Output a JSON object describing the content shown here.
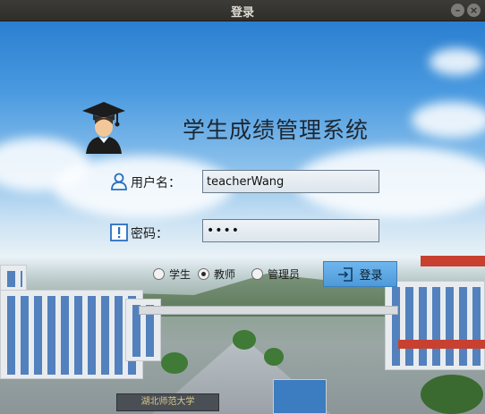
{
  "window": {
    "title": "登录"
  },
  "app": {
    "title": "学生成绩管理系统"
  },
  "form": {
    "username_label": "用户名：",
    "username_value": "teacherWang",
    "password_label": "密码：",
    "password_value": "••••"
  },
  "roles": [
    {
      "label": "学生",
      "checked": false
    },
    {
      "label": "教师",
      "checked": true
    },
    {
      "label": "管理员",
      "checked": false
    }
  ],
  "login_button": {
    "label": "登录"
  },
  "background": {
    "gate_sign": "湖北师范大学"
  },
  "colors": {
    "accent": "#4e9ad8",
    "icon_blue": "#2a6fc0"
  },
  "icons": [
    "graduate-logo-icon",
    "user-icon",
    "exclamation-icon",
    "login-enter-icon",
    "minimize-icon",
    "close-icon"
  ]
}
